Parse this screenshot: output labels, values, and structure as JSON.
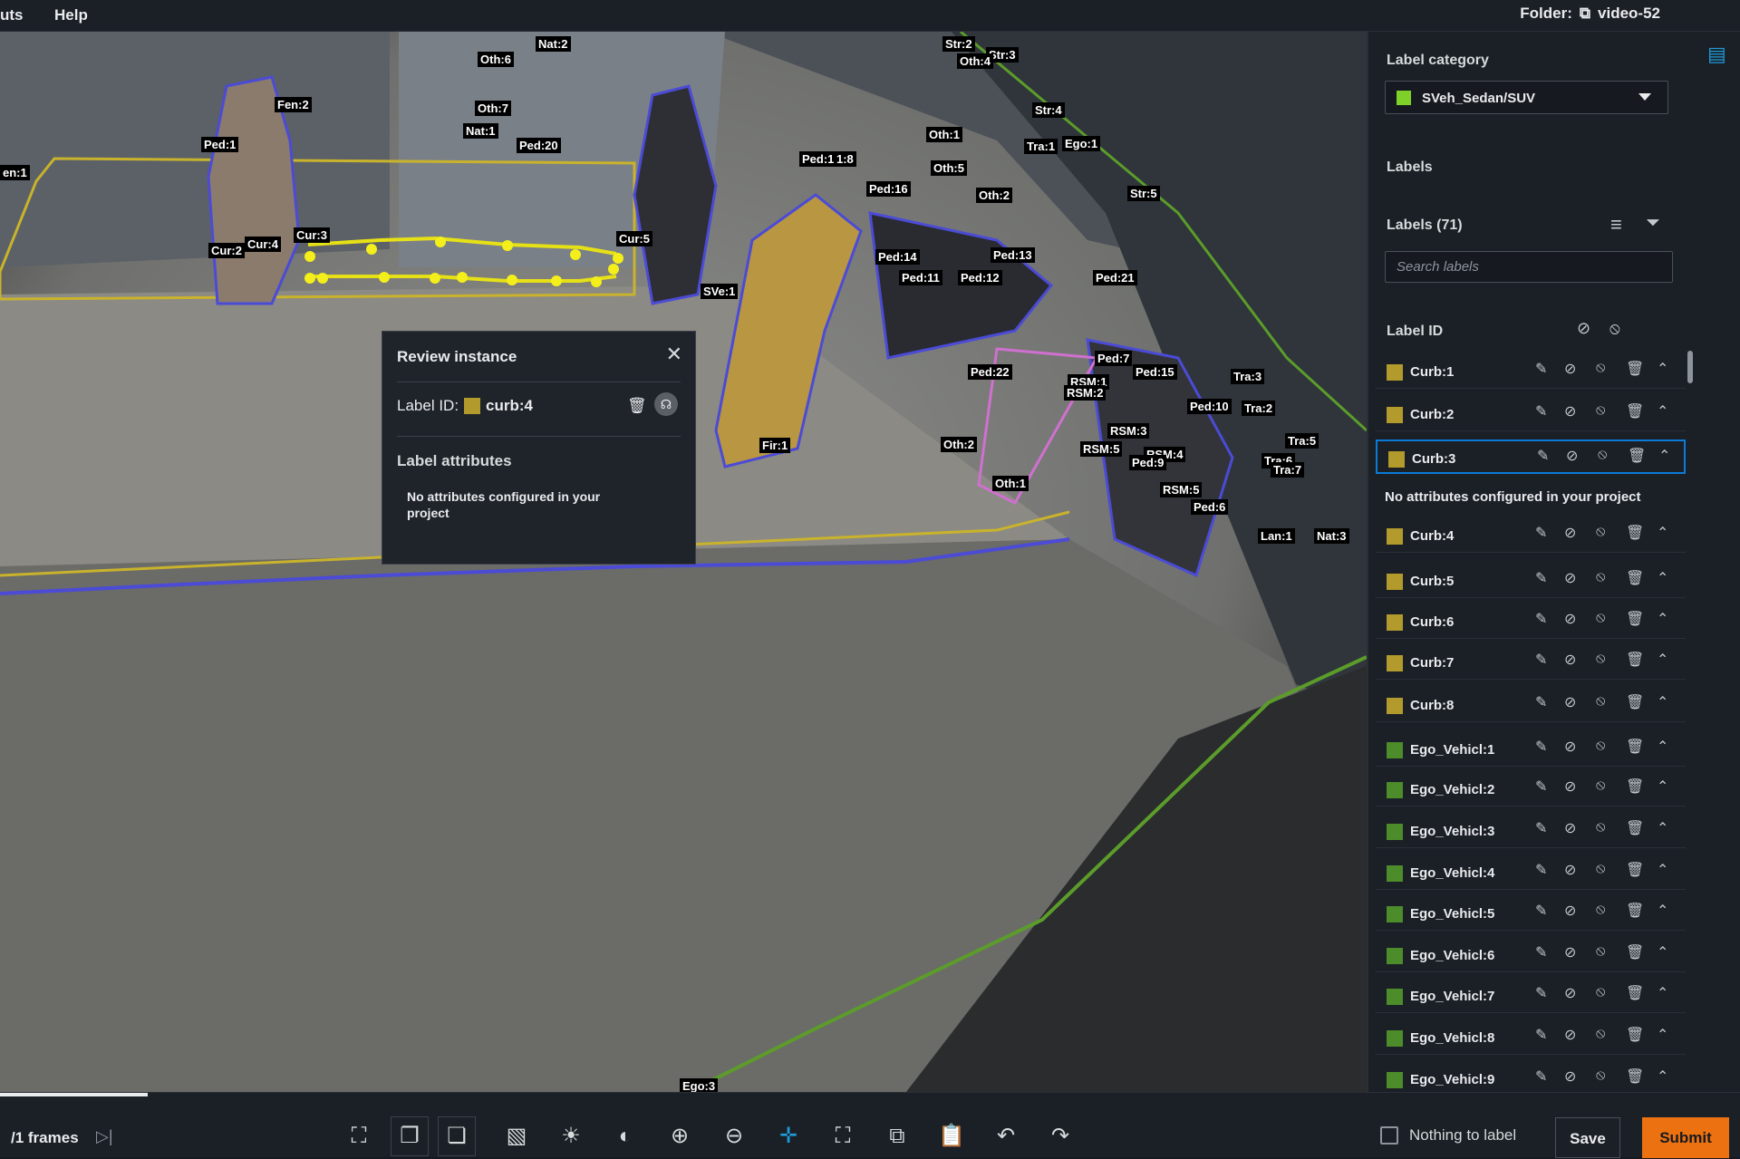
{
  "topbar": {
    "menu_shortcuts": "uts",
    "menu_help": "Help",
    "folder_label": "Folder:",
    "folder_name": "video-52"
  },
  "review": {
    "title": "Review instance",
    "label_id_prefix": "Label ID:",
    "label_id": "curb:4",
    "label_color": "#b29a2c",
    "attributes_heading": "Label attributes",
    "attributes_note": "No  attributes configured in your project"
  },
  "canvas_tags": [
    "en:1",
    "Fen:2",
    "Ped:1",
    "Cur:2",
    "Cur:4",
    "Cur:3",
    "Oth:6",
    "Nat:2",
    "Oth:7",
    "Nat:1",
    "Ped:20",
    "Cur:5",
    "SVe:1",
    "Ped:17",
    "1:8",
    "Str:2",
    "Str:3",
    "Oth:4",
    "Str:4",
    "Oth:1",
    "Tra:1",
    "Ego:1",
    "Oth:5",
    "Oth:2",
    "Ped:16",
    "Str:5",
    "Ped:14",
    "Ped:11",
    "Ped:12",
    "Ped:13",
    "Ped:21",
    "Ped:22",
    "Ped:7",
    "Ped:15",
    "RSM:1",
    "RSM:2",
    "Tra:3",
    "Tra:2",
    "Ped:10",
    "RSM:3",
    "RSM:4",
    "RSM:5",
    "Ped:9",
    "Tra:5",
    "Tra:6",
    "Tra:7",
    "RSM:5",
    "Ped:6",
    "Lan:1",
    "Nat:3",
    "Fir:1",
    "Oth:2",
    "Oth:1",
    "Ego:3"
  ],
  "sidebar": {
    "category_heading": "Label category",
    "category_value": "SVeh_Sedan/SUV",
    "category_color": "#7fd12a",
    "labels_heading": "Labels",
    "labels_count": "Labels (71)",
    "search_placeholder": "Search labels",
    "label_id_heading": "Label ID",
    "selected_note": "No attributes configured in your project",
    "items": [
      {
        "name": "Curb:1",
        "color": "#b29a2c"
      },
      {
        "name": "Curb:2",
        "color": "#b29a2c"
      },
      {
        "name": "Curb:3",
        "color": "#b29a2c"
      },
      {
        "name": "Curb:4",
        "color": "#b29a2c"
      },
      {
        "name": "Curb:5",
        "color": "#b29a2c"
      },
      {
        "name": "Curb:6",
        "color": "#b29a2c"
      },
      {
        "name": "Curb:7",
        "color": "#b29a2c"
      },
      {
        "name": "Curb:8",
        "color": "#b29a2c"
      },
      {
        "name": "Ego_Vehicl:1",
        "color": "#4c8c2b"
      },
      {
        "name": "Ego_Vehicl:2",
        "color": "#4c8c2b"
      },
      {
        "name": "Ego_Vehicl:3",
        "color": "#4c8c2b"
      },
      {
        "name": "Ego_Vehicl:4",
        "color": "#4c8c2b"
      },
      {
        "name": "Ego_Vehicl:5",
        "color": "#4c8c2b"
      },
      {
        "name": "Ego_Vehicl:6",
        "color": "#4c8c2b"
      },
      {
        "name": "Ego_Vehicl:7",
        "color": "#4c8c2b"
      },
      {
        "name": "Ego_Vehicl:8",
        "color": "#4c8c2b"
      },
      {
        "name": "Ego_Vehicl:9",
        "color": "#4c8c2b"
      }
    ]
  },
  "footer": {
    "frames": "/1 frames",
    "nothing_to_label": "Nothing to label",
    "save": "Save",
    "submit": "Submit"
  },
  "icons": [
    "polygon-tool-icon",
    "copy-icon",
    "copy-all-icon",
    "layers-icon",
    "brightness-icon",
    "contrast-icon",
    "zoom-in-icon",
    "zoom-out-icon",
    "move-icon",
    "fit-icon",
    "duplicate-icon",
    "paste-icon",
    "undo-icon",
    "redo-icon"
  ]
}
